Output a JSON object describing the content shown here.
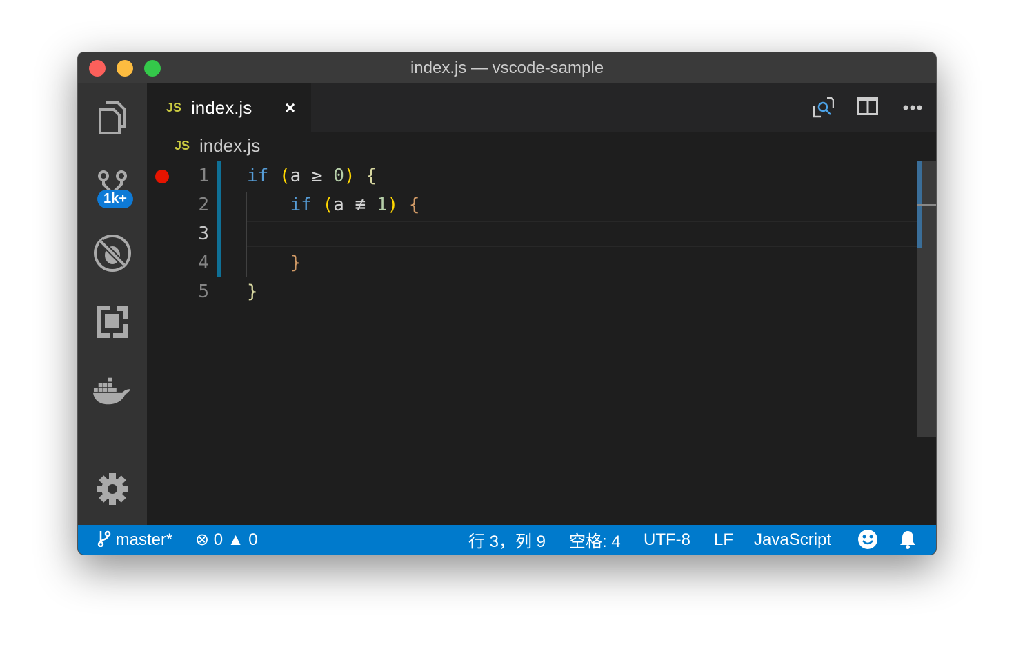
{
  "window": {
    "title": "index.js — vscode-sample"
  },
  "activity_bar": {
    "items": [
      {
        "name": "explorer",
        "icon": "files-icon"
      },
      {
        "name": "source-control",
        "icon": "source-control-icon",
        "badge": "1k+"
      },
      {
        "name": "debug",
        "icon": "debug-disabled-icon"
      },
      {
        "name": "extensions",
        "icon": "extensions-icon"
      },
      {
        "name": "docker",
        "icon": "docker-icon"
      }
    ],
    "settings_icon": "gear-icon"
  },
  "tab": {
    "lang_icon": "JS",
    "label": "index.js",
    "close": "×"
  },
  "breadcrumb": {
    "lang_icon": "JS",
    "label": "index.js"
  },
  "editor": {
    "line_numbers": [
      "1",
      "2",
      "3",
      "4",
      "5"
    ],
    "current_line": 3,
    "breakpoint_line": 1
  },
  "colors": {
    "status_bar": "#007acc",
    "keyword": "#569cd6",
    "breakpoint": "#e51400"
  },
  "status": {
    "branch": "master*",
    "errors": "0",
    "warnings": "0",
    "position": "行 3，列 9",
    "indent": "空格: 4",
    "encoding": "UTF-8",
    "eol": "LF",
    "language": "JavaScript"
  }
}
